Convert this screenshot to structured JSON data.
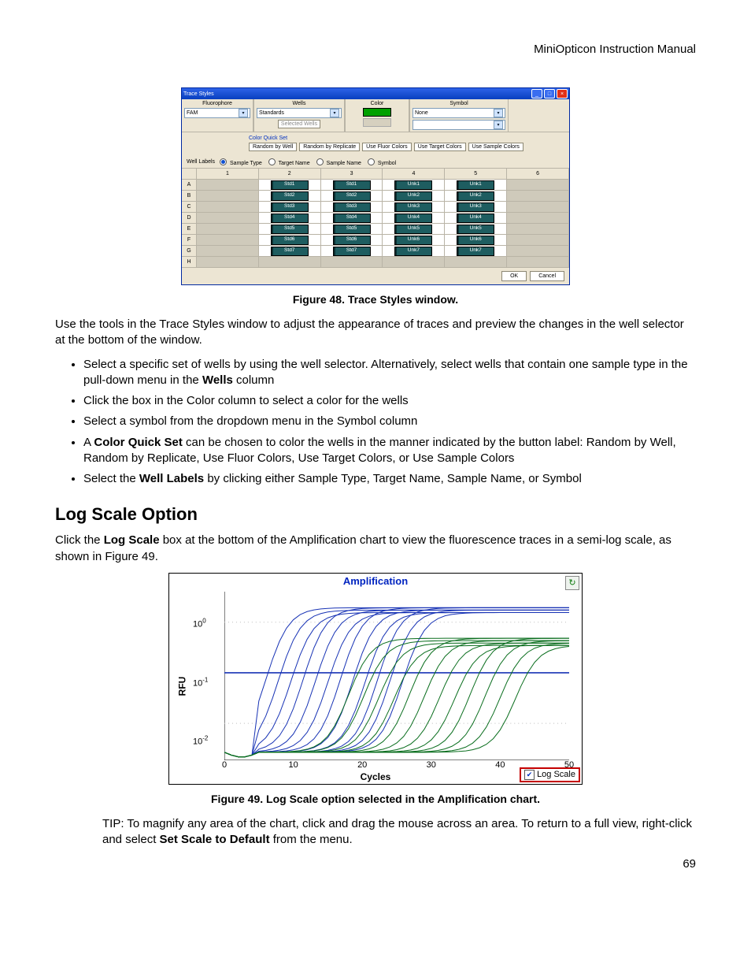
{
  "header": {
    "running": "MiniOpticon Instruction Manual",
    "page_number": "69"
  },
  "figures": {
    "f48": "Figure 48. Trace Styles window.",
    "f49": "Figure 49. Log Scale option selected in the Amplification chart."
  },
  "paragraphs": {
    "p1": "Use the tools in the Trace Styles window to adjust the appearance of traces and preview the changes in the well selector at the bottom of the window.",
    "b1a": "Select a specific set of wells by using the well selector. Alternatively, select wells that contain one sample type in the pull-down menu in the ",
    "b1b": "Wells",
    "b1c": " column",
    "b2": "Click the box in the Color column to select a color for the wells",
    "b3": "Select a symbol from the dropdown menu in the Symbol column",
    "b4a": "A ",
    "b4b": "Color Quick Set",
    "b4c": " can be chosen to color the wells in the manner indicated by the button label: Random by Well, Random by Replicate, Use Fluor Colors, Use Target Colors, or Use Sample Colors",
    "b5a": "Select the ",
    "b5b": "Well Labels",
    "b5c": " by clicking either Sample Type, Target Name, Sample Name, or Symbol",
    "p2a": "Click the ",
    "p2b": "Log Scale",
    "p2c": " box at the bottom of the Amplification chart to view the fluorescence traces in a semi-log scale, as shown in Figure 49.",
    "tip_a": "TIP: To magnify any area of the chart, click and drag the mouse across an area. To return to a full view, right-click and select ",
    "tip_b": "Set Scale to Default",
    "tip_c": " from the menu."
  },
  "section": {
    "log": "Log Scale Option"
  },
  "trace_styles": {
    "title": "Trace Styles",
    "cols": {
      "fluor": "Fluorophore",
      "wells": "Wells",
      "color": "Color",
      "symbol": "Symbol"
    },
    "fluor_value": "FAM",
    "wells_value": "Standards",
    "selected_wells": "Selected Wells",
    "symbol_value": "None",
    "quickset_label": "Color Quick Set",
    "quickset": [
      "Random by Well",
      "Random by Replicate",
      "Use Fluor Colors",
      "Use Target Colors",
      "Use Sample Colors"
    ],
    "well_labels": "Well Labels",
    "radios": [
      "Sample Type",
      "Target Name",
      "Sample Name",
      "Symbol"
    ],
    "grid_cols": [
      "1",
      "2",
      "3",
      "4",
      "5",
      "6"
    ],
    "grid_rows": [
      "A",
      "B",
      "C",
      "D",
      "E",
      "F",
      "G",
      "H"
    ],
    "cells": {
      "A": [
        "",
        "Std1",
        "Std1",
        "Unk1",
        "Unk1",
        ""
      ],
      "B": [
        "",
        "Std2",
        "Std2",
        "Unk2",
        "Unk2",
        ""
      ],
      "C": [
        "",
        "Std3",
        "Std3",
        "Unk3",
        "Unk3",
        ""
      ],
      "D": [
        "",
        "Std4",
        "Std4",
        "Unk4",
        "Unk4",
        ""
      ],
      "E": [
        "",
        "Std5",
        "Std5",
        "Unk5",
        "Unk5",
        ""
      ],
      "F": [
        "",
        "Std6",
        "Std6",
        "Unk6",
        "Unk6",
        ""
      ],
      "G": [
        "",
        "Std7",
        "Std7",
        "Unk7",
        "Unk7",
        ""
      ],
      "H": [
        "",
        "",
        "",
        "",
        "",
        ""
      ]
    },
    "ok": "OK",
    "cancel": "Cancel"
  },
  "amp": {
    "title": "Amplification",
    "ylabel": "RFU",
    "xlabel": "Cycles",
    "yticks": [
      "10^0",
      "10^-1",
      "10^-2"
    ],
    "xticks": [
      "0",
      "10",
      "20",
      "30",
      "40",
      "50"
    ],
    "log_checkbox": "Log Scale",
    "refresh": "↻"
  },
  "chart_data": {
    "type": "line",
    "title": "Amplification",
    "xlabel": "Cycles",
    "ylabel": "RFU",
    "x_range": [
      0,
      50
    ],
    "y_scale": "log10",
    "y_range": [
      0.003,
      3
    ],
    "yticks": [
      0.01,
      0.1,
      1
    ],
    "note": "Semi-log amplification plot with many sigmoidal traces. Blue traces (standards) rise earlier (~cycles 5-25) and plateau near RFU 1. Green traces (unknowns) rise later (~cycles 15-40) and plateau lower, near RFU 0.3-0.5. A horizontal blue threshold line is drawn near RFU 0.1.",
    "threshold": 0.1,
    "series_summary": [
      {
        "group": "blue",
        "n_traces_approx": 12,
        "ct_range": [
          6,
          26
        ],
        "plateau_approx": 1.0
      },
      {
        "group": "green",
        "n_traces_approx": 12,
        "ct_range": [
          18,
          42
        ],
        "plateau_approx": 0.4
      }
    ]
  }
}
